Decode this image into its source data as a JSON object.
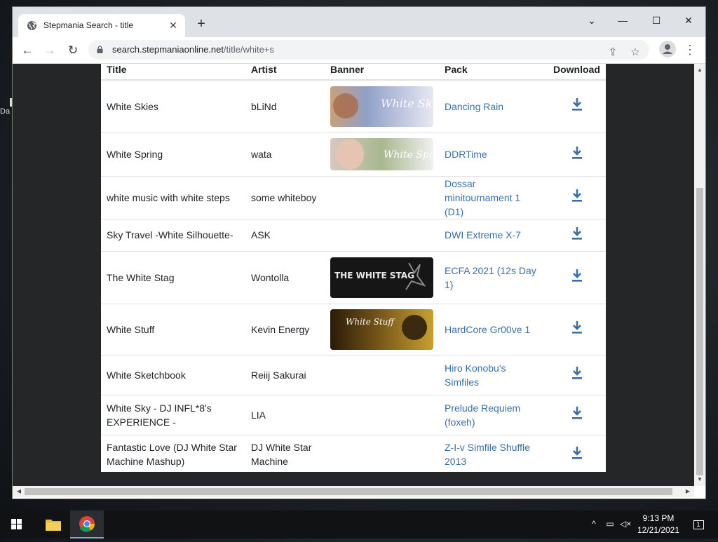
{
  "desktop": {
    "fragment": "Da"
  },
  "tab": {
    "title": "Stepmania Search - title",
    "close": "✕"
  },
  "newtab": "+",
  "window_controls": {
    "minimize": "⌄",
    "restore": "—",
    "maximize": "☐",
    "close": "✕"
  },
  "toolbar": {
    "url_host": "search.stepmaniaonline.net",
    "url_path": "/title/white+s"
  },
  "table": {
    "headers": [
      "Title",
      "Artist",
      "Banner",
      "Pack",
      "Download"
    ],
    "rows": [
      {
        "title": "White Skies",
        "artist": "bLiNd",
        "banner": "White Skies",
        "pack": "Dancing Rain"
      },
      {
        "title": "White Spring",
        "artist": "wata",
        "banner": "White Spring",
        "pack": "DDRTime"
      },
      {
        "title": "white music with white steps",
        "artist": "some whiteboy",
        "banner": "",
        "pack": "Dossar minitournament 1 (D1)"
      },
      {
        "title": "Sky Travel -White Silhouette-",
        "artist": "ASK",
        "banner": "",
        "pack": "DWI Extreme X-7"
      },
      {
        "title": "The White Stag",
        "artist": "Wontolla",
        "banner": "THE WHITE STAG",
        "pack": "ECFA 2021 (12s Day 1)"
      },
      {
        "title": "White Stuff",
        "artist": "Kevin Energy",
        "banner": "White Stuff",
        "pack": "HardCore Gr00ve 1"
      },
      {
        "title": "White Sketchbook",
        "artist": "Reiij Sakurai",
        "banner": "",
        "pack": "Hiro Konobu's Simfiles"
      },
      {
        "title": "White Sky - DJ INFL*8's EXPERIENCE -",
        "artist": "LIA",
        "banner": "",
        "pack": "Prelude Requiem (foxeh)"
      },
      {
        "title": "Fantastic Love (DJ White Star Machine Mashup)",
        "artist": "DJ White Star Machine",
        "banner": "",
        "pack": "Z-I-v Simfile Shuffle 2013"
      }
    ]
  },
  "taskbar": {
    "time": "9:13 PM",
    "date": "12/21/2021",
    "notifications": "1"
  },
  "colors": {
    "link": "#3b6fa8",
    "page_bg": "#252627"
  }
}
